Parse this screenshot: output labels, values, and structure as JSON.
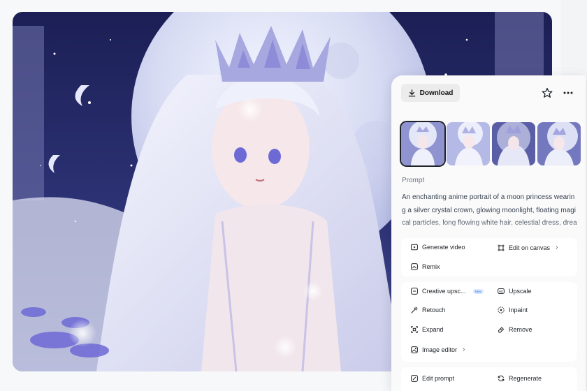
{
  "image": {
    "alt": "An enchanting anime portrait of a moon princess",
    "palette": {
      "sky": "#2b2f6e",
      "moon": "#dfe3f6",
      "hair": "#e9eaf6",
      "crystal": "#8e8bd8",
      "flowers": "#6d69d6"
    }
  },
  "toolbar": {
    "download_label": "Download",
    "download_icon": "download-icon",
    "favorite_icon": "star-icon",
    "more_icon": "more-horizontal-icon"
  },
  "thumbnails": [
    {
      "label": "variation 1",
      "selected": true
    },
    {
      "label": "variation 2",
      "selected": false
    },
    {
      "label": "variation 3",
      "selected": false
    },
    {
      "label": "variation 4",
      "selected": false
    }
  ],
  "prompt": {
    "label": "Prompt",
    "text": "An enchanting anime portrait of a moon princess wearing a silver crystal crown, glowing moonlight, floating magical particles, long flowing white hair, celestial dress, dreamy atmosphere"
  },
  "actions": {
    "generate_video": "Generate video",
    "edit_on_canvas": "Edit on canvas",
    "remix": "Remix",
    "creative_upscale": "Creative upsc...",
    "new_badge": "New",
    "upscale": "Upscale",
    "retouch": "Retouch",
    "inpaint": "Inpaint",
    "expand": "Expand",
    "remove": "Remove",
    "image_editor": "Image editor",
    "edit_prompt": "Edit prompt",
    "regenerate": "Regenerate"
  },
  "accent_cursor_color": "#f26d6d"
}
